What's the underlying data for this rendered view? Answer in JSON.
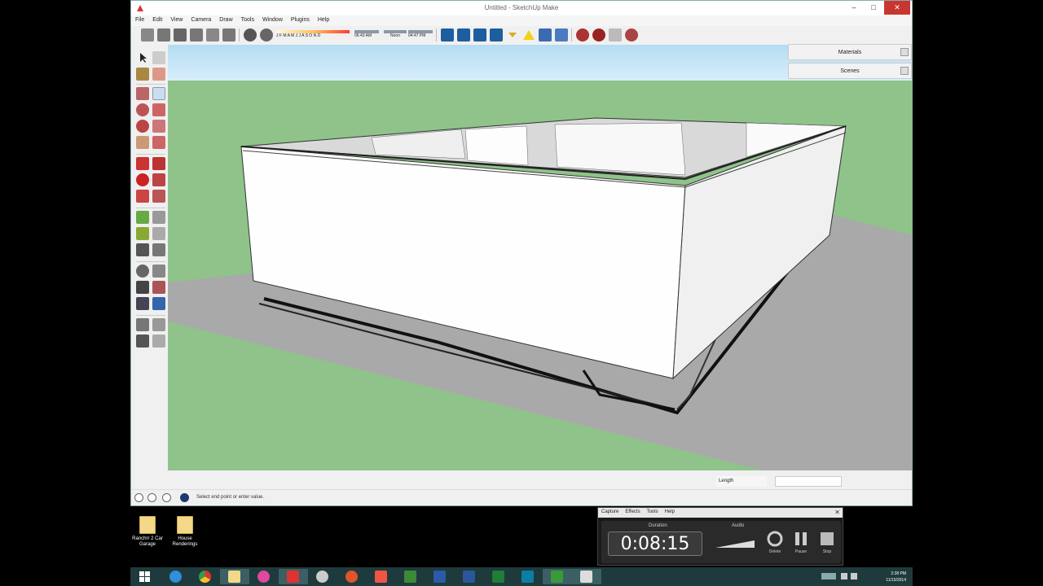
{
  "window": {
    "title": "Untitled - SketchUp Make",
    "min_glyph": "–",
    "max_glyph": "□",
    "close_glyph": "✕"
  },
  "menu": [
    "File",
    "Edit",
    "View",
    "Camera",
    "Draw",
    "Tools",
    "Window",
    "Plugins",
    "Help"
  ],
  "toolbar": {
    "shadow_months": "J F M A M J J A S O N D",
    "shadow_time_start": "06:43 AM",
    "shadow_noon": "Noon",
    "shadow_time_end": "04:47 PM"
  },
  "trays": {
    "materials": "Materials",
    "scenes": "Scenes"
  },
  "status": {
    "text": "Select end point or enter value.",
    "measurement_label": "Length"
  },
  "desktop": {
    "icons": [
      {
        "label": "Ranchrr 2 Car Garage",
        "icon": "folder-icon"
      },
      {
        "label": "House Renderings",
        "icon": "folder-icon"
      }
    ]
  },
  "recorder": {
    "menus": [
      "Capture",
      "Effects",
      "Tools",
      "Help"
    ],
    "close_glyph": "✕",
    "duration_label": "Duration",
    "duration": "0:08:15",
    "audio_label": "Audio",
    "delete_label": "Delete",
    "pause_label": "Pause",
    "stop_label": "Stop"
  },
  "taskbar": {
    "time": "2:38 PM",
    "date": "11/15/2014"
  },
  "colors": {
    "sky": "#bde0f5",
    "ground": "#8fc38a",
    "shadow": "#a8a8a8",
    "wall": "#ffffff",
    "taskbar": "#1f3a3c"
  }
}
